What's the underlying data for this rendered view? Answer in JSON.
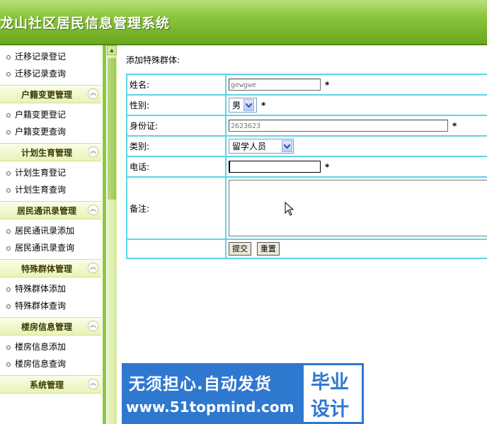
{
  "app": {
    "title": "龙山社区居民信息管理系统"
  },
  "sidebar": {
    "top_items": [
      "迁移记录登记",
      "迁移记录查询"
    ],
    "groups": [
      {
        "title": "户籍变更管理",
        "items": [
          "户籍变更登记",
          "户籍变更查询"
        ]
      },
      {
        "title": "计划生育管理",
        "items": [
          "计划生育登记",
          "计划生育查询"
        ]
      },
      {
        "title": "居民通讯录管理",
        "items": [
          "居民通讯录添加",
          "居民通讯录查询"
        ]
      },
      {
        "title": "特殊群体管理",
        "items": [
          "特殊群体添加",
          "特殊群体查询"
        ]
      },
      {
        "title": "楼房信息管理",
        "items": [
          "楼房信息添加",
          "楼房信息查询"
        ]
      },
      {
        "title": "系统管理",
        "items": []
      }
    ]
  },
  "form": {
    "section_title": "添加特殊群体:",
    "name": {
      "label": "姓名:",
      "value": "gewgwe",
      "required": "*"
    },
    "gender": {
      "label": "性别:",
      "value": "男",
      "required": "*"
    },
    "id_card": {
      "label": "身份证:",
      "value": "2623623",
      "required": "*"
    },
    "category": {
      "label": "类别:",
      "value": "留学人员"
    },
    "phone": {
      "label": "电话:",
      "value": "",
      "required": "*"
    },
    "notes": {
      "label": "备注:",
      "value": ""
    },
    "submit_label": "提交",
    "reset_label": "重置"
  },
  "watermark": {
    "line1": "无须担心.自动发货",
    "line2": "www.51topmind.com",
    "right1": "毕业",
    "right2": "设计"
  },
  "colors": {
    "header_green": "#8dc63f",
    "table_border": "#5bd6e6",
    "watermark_blue": "#2f78d0"
  }
}
